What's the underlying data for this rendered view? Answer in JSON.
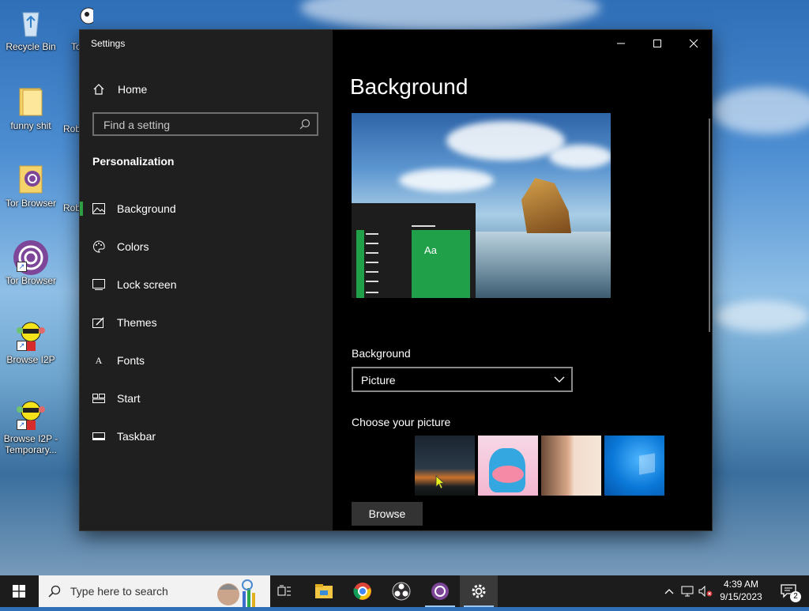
{
  "desktop": {
    "icons": [
      {
        "label": "Recycle Bin"
      },
      {
        "label": "funny shit"
      },
      {
        "label": "Tor Browser"
      },
      {
        "label": "Tor Browser"
      },
      {
        "label": "Browse I2P"
      },
      {
        "label": "Browse I2P - Temporary..."
      }
    ],
    "partial_labels": [
      "To",
      "Rob",
      "Rob"
    ]
  },
  "window": {
    "title": "Settings",
    "controls": {
      "minimize": "minimize",
      "maximize": "maximize",
      "close": "close"
    }
  },
  "sidebar": {
    "home_label": "Home",
    "search_placeholder": "Find a setting",
    "section_title": "Personalization",
    "items": [
      {
        "label": "Background",
        "icon": "picture-icon",
        "active": true
      },
      {
        "label": "Colors",
        "icon": "palette-icon"
      },
      {
        "label": "Lock screen",
        "icon": "lock-screen-icon"
      },
      {
        "label": "Themes",
        "icon": "themes-icon"
      },
      {
        "label": "Fonts",
        "icon": "fonts-icon"
      },
      {
        "label": "Start",
        "icon": "start-icon"
      },
      {
        "label": "Taskbar",
        "icon": "taskbar-icon"
      }
    ]
  },
  "content": {
    "page_title": "Background",
    "preview_tile_text": "Aa",
    "background_label": "Background",
    "background_value": "Picture",
    "choose_label": "Choose your picture",
    "browse_label": "Browse"
  },
  "taskbar": {
    "search_placeholder": "Type here to search",
    "time": "4:39 AM",
    "date": "9/15/2023",
    "notification_count": "2"
  },
  "colors": {
    "accent": "#2ea043",
    "sidebar_bg": "#1f1f1f",
    "content_bg": "#000000",
    "taskbar_bg": "#1c1c1c"
  }
}
